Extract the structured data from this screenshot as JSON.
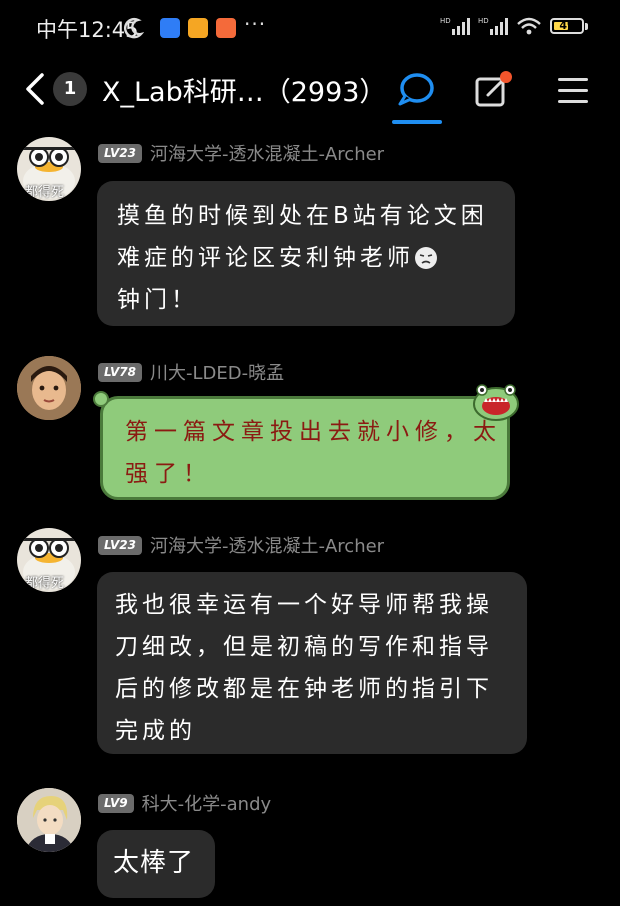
{
  "status_bar": {
    "time": "中午12:45",
    "more": "···",
    "battery": "49"
  },
  "header": {
    "unread_count": "1",
    "title": "X_Lab科研…（2993）"
  },
  "messages": [
    {
      "level": "LV23",
      "sender": "河海大学-透水混凝土-Archer",
      "avatar_caption": "都得死",
      "lines": [
        "摸鱼的时候到处在B站有论文困",
        "难症的评论区安利钟老师",
        "钟门！"
      ]
    },
    {
      "level": "LV78",
      "sender": "川大-LDED-晓孟",
      "lines": [
        "第一篇文章投出去就小修，太",
        "强了！"
      ]
    },
    {
      "level": "LV23",
      "sender": "河海大学-透水混凝土-Archer",
      "avatar_caption": "都得死",
      "lines": [
        "我也很幸运有一个好导师帮我操",
        "刀细改，但是初稿的写作和指导",
        "后的修改都是在钟老师的指引下",
        "完成的"
      ]
    },
    {
      "level": "LV9",
      "sender": "科大-化学-andy",
      "lines": [
        "太棒了"
      ]
    }
  ],
  "colors": {
    "background": "#000000",
    "bubble": "#2b2b2b",
    "green_bubble": "#8fcb7b",
    "green_text": "#8b1a12",
    "accent": "#1f8ef1",
    "badge_red": "#f2552c"
  },
  "icons": {
    "back": "chevron-left-icon",
    "chat": "chat-bubble-icon",
    "edit": "edit-icon",
    "menu": "hamburger-menu-icon"
  }
}
